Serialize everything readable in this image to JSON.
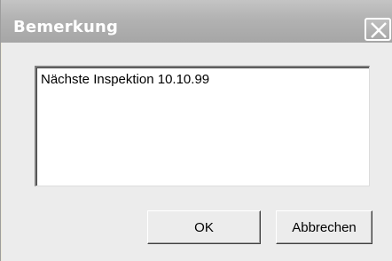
{
  "dialog": {
    "title": "Bemerkung",
    "close_icon": "close-icon"
  },
  "memo": {
    "value": "Nächste Inspektion 10.10.99"
  },
  "buttons": {
    "ok_label": "OK",
    "cancel_label": "Abbrechen"
  },
  "colors": {
    "titlebar": "#b2b2b2",
    "dialog_background": "#ececec",
    "memo_background": "#ffffff"
  }
}
